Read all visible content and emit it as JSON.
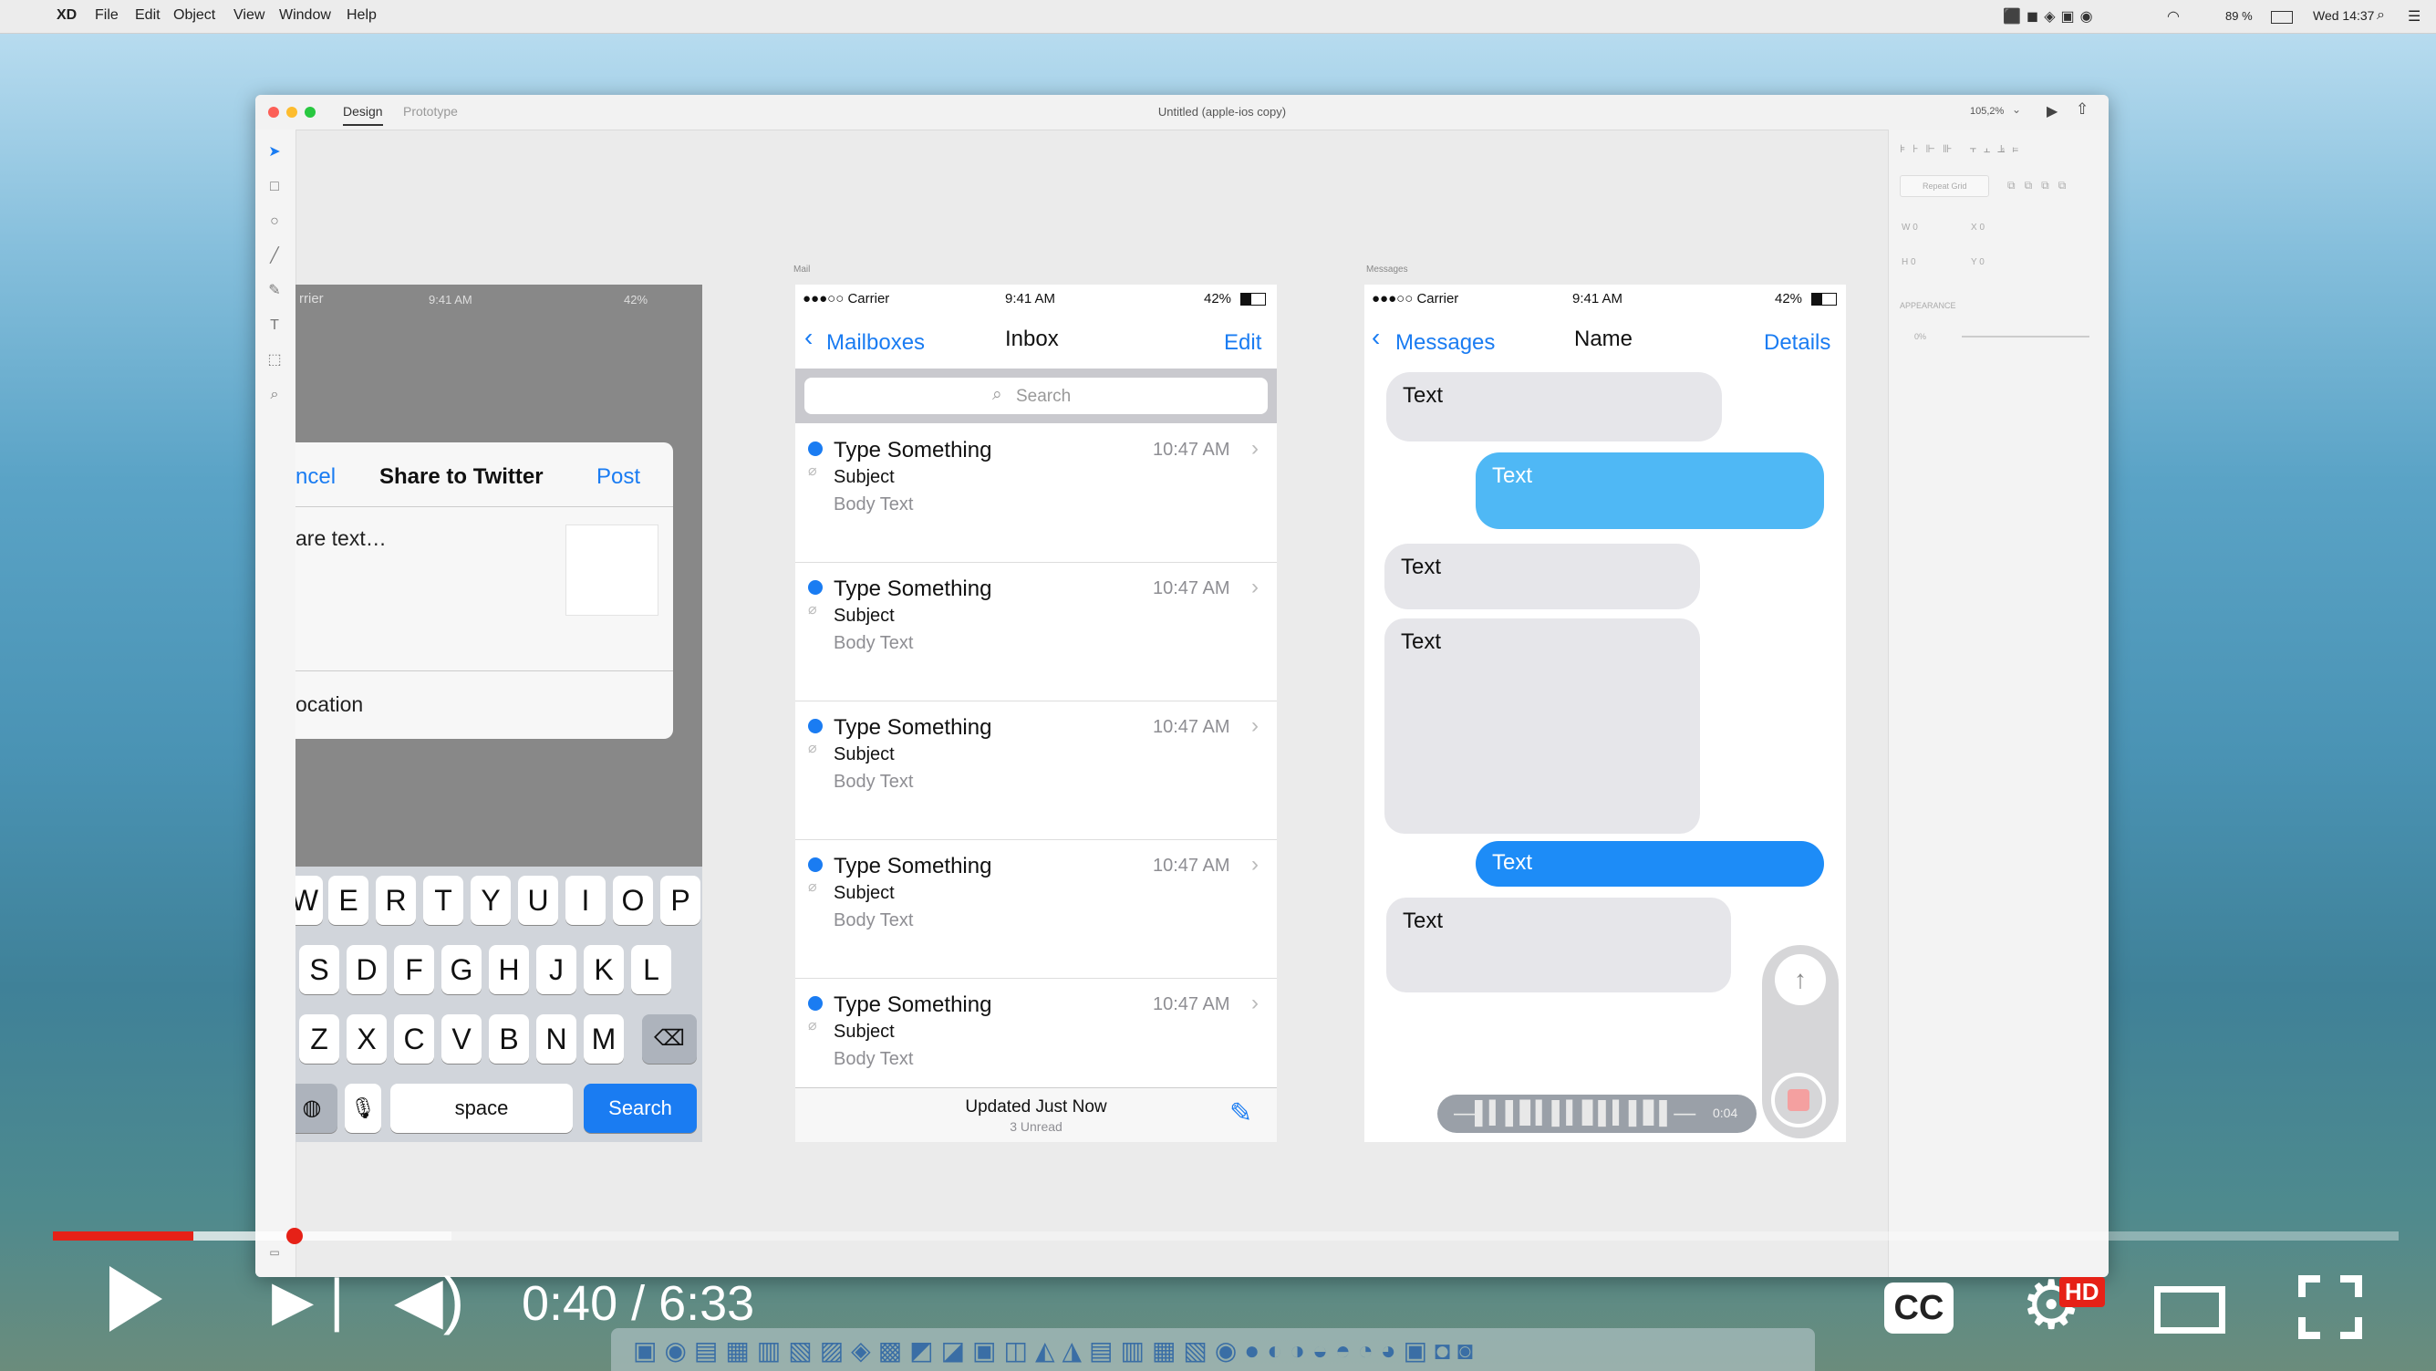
{
  "menubar": {
    "apple": "",
    "app": "XD",
    "items": [
      "File",
      "Edit",
      "Object",
      "View",
      "Window",
      "Help"
    ],
    "battery": "89 %",
    "clock": "Wed 14:37"
  },
  "xd": {
    "tabs": [
      "Design",
      "Prototype"
    ],
    "title": "Untitled (apple-ios copy)",
    "zoom": "105,2%",
    "props": {
      "repeat_grid": "Repeat Grid",
      "w": "W 0",
      "x": "X 0",
      "h": "H 0",
      "y": "Y 0",
      "appearance": "APPEARANCE",
      "opacity": "0%"
    },
    "artboard_labels": [
      "Mail",
      "Messages"
    ]
  },
  "share": {
    "status_carrier": "rrier",
    "status_time": "9:41 AM",
    "status_batt": "42%",
    "cancel": "ncel",
    "title": "Share to Twitter",
    "post": "Post",
    "placeholder": "are text…",
    "location": "ocation",
    "kb_row1": [
      "W",
      "E",
      "R",
      "T",
      "Y",
      "U",
      "I",
      "O",
      "P"
    ],
    "kb_row2": [
      "S",
      "D",
      "F",
      "G",
      "H",
      "J",
      "K",
      "L"
    ],
    "kb_row3": [
      "Z",
      "X",
      "C",
      "V",
      "B",
      "N",
      "M"
    ],
    "space": "space",
    "search": "Search"
  },
  "mail": {
    "status_carrier": "●●●○○ Carrier",
    "status_time": "9:41 AM",
    "status_batt": "42%",
    "back": "Mailboxes",
    "title": "Inbox",
    "edit": "Edit",
    "search": "Search",
    "rows": [
      {
        "from": "Type Something",
        "subject": "Subject",
        "body": "Body Text",
        "time": "10:47 AM"
      },
      {
        "from": "Type Something",
        "subject": "Subject",
        "body": "Body Text",
        "time": "10:47 AM"
      },
      {
        "from": "Type Something",
        "subject": "Subject",
        "body": "Body Text",
        "time": "10:47 AM"
      },
      {
        "from": "Type Something",
        "subject": "Subject",
        "body": "Body Text",
        "time": "10:47 AM"
      },
      {
        "from": "Type Something",
        "subject": "Subject",
        "body": "Body Text",
        "time": "10:47 AM"
      }
    ],
    "footer_title": "Updated Just Now",
    "footer_sub": "3 Unread"
  },
  "messages": {
    "status_carrier": "●●●○○ Carrier",
    "status_time": "9:41 AM",
    "status_batt": "42%",
    "back": "Messages",
    "title": "Name",
    "details": "Details",
    "bubbles": [
      "Text",
      "Text",
      "Text",
      "Text",
      "Text",
      "Text"
    ],
    "audio_time": "0:04"
  },
  "video": {
    "time": "0:40 / 6:33",
    "cc": "CC",
    "hd": "HD",
    "progress": 0.06,
    "buffered": 0.17
  }
}
